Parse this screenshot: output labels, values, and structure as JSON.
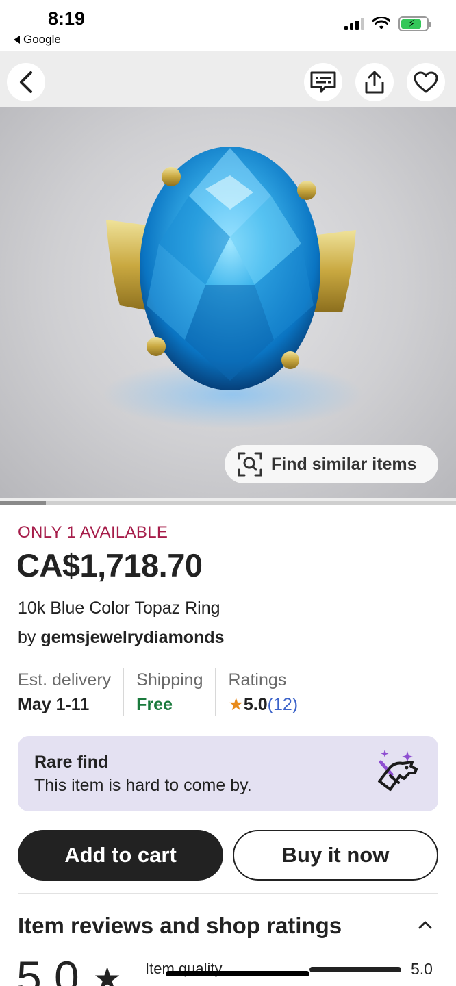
{
  "status_bar": {
    "time": "8:19",
    "back_app": "Google",
    "battery_level": 0.8
  },
  "gallery": {
    "find_similar_label": "Find similar items",
    "image_position": 0.1
  },
  "listing": {
    "availability": "ONLY 1 AVAILABLE",
    "price": "CA$1,718.70",
    "title": "10k Blue Color Topaz Ring",
    "by_prefix": "by",
    "shop_name": "gemsjewelrydiamonds"
  },
  "facts": {
    "delivery_label": "Est. delivery",
    "delivery_value": "May 1-11",
    "shipping_label": "Shipping",
    "shipping_value": "Free",
    "ratings_label": "Ratings",
    "ratings_value": "5.0",
    "ratings_count": "(12)"
  },
  "rare_find": {
    "title": "Rare find",
    "subtitle": "This item is hard to come by."
  },
  "actions": {
    "add_to_cart": "Add to cart",
    "buy_now": "Buy it now"
  },
  "reviews": {
    "section_title": "Item reviews and shop ratings",
    "overall_rating": "5.0",
    "quality_label": "Item quality",
    "quality_value": "5.0"
  },
  "icons": {
    "back": "chevron-left-icon",
    "message": "message-icon",
    "share": "share-icon",
    "favorite": "heart-icon",
    "visual_search": "visual-search-icon",
    "rare": "unicorn-icon",
    "collapse": "chevron-up-icon"
  },
  "colors": {
    "availability": "#a61d4a",
    "shipping_free": "#1b7a3d",
    "rare_card_bg": "#e4e1f2",
    "star": "#e88a1a",
    "ratings_count": "#3b62c9"
  }
}
